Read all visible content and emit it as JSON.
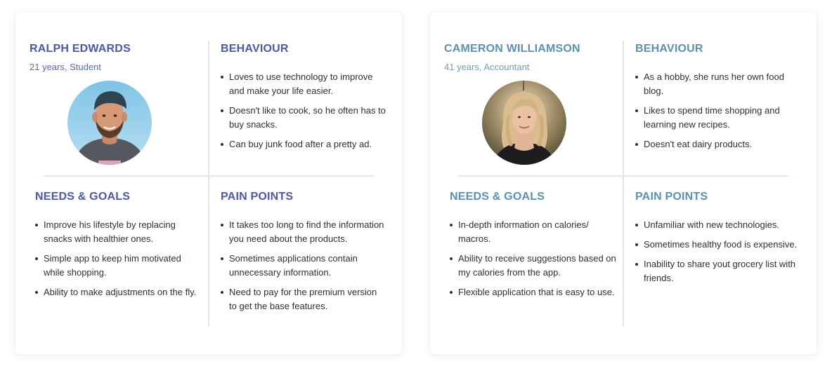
{
  "personas": [
    {
      "name": "RALPH EDWARDS",
      "subtitle": "21 years, Student",
      "avatar_icon": "person-photo-icon",
      "behaviour": {
        "title": "BEHAVIOUR",
        "items": [
          "Loves to use technology to improve and make your life easier.",
          "Doesn't like to cook, so he often has to buy snacks.",
          "Can buy junk food after a pretty ad."
        ]
      },
      "needs": {
        "title": "NEEDS & GOALS",
        "items": [
          "Improve his lifestyle by replacing snacks with healthier ones.",
          "Simple app to keep him motivated while shopping.",
          "Ability to make adjustments on the fly."
        ]
      },
      "pain": {
        "title": "PAIN POINTS",
        "items": [
          "It takes too long to find the information you need about the products.",
          "Sometimes applications contain unnecessary information.",
          "Need to pay for the premium version to get the base features."
        ]
      }
    },
    {
      "name": "CAMERON WILLIAMSON",
      "subtitle": "41 years, Accountant",
      "avatar_icon": "person-photo-icon",
      "behaviour": {
        "title": "BEHAVIOUR",
        "items": [
          "As a hobby, she runs her own food blog.",
          "Likes to spend time shopping and learning new recipes.",
          "Doesn't eat dairy products."
        ]
      },
      "needs": {
        "title": "NEEDS & GOALS",
        "items": [
          "In-depth information on calories/ macros.",
          "Ability to receive suggestions based on my calories from the app.",
          "Flexible application that is easy to use."
        ]
      },
      "pain": {
        "title": "PAIN POINTS",
        "items": [
          "Unfamiliar with new technologies.",
          "Sometimes healthy food is expensive.",
          "Inability to share yout grocery list with friends."
        ]
      }
    }
  ],
  "colors": {
    "persona1_accent": "#4a58b5",
    "persona2_accent": "#5a91b6",
    "divider": "#dde6f1",
    "body_text": "#2b2f38"
  }
}
